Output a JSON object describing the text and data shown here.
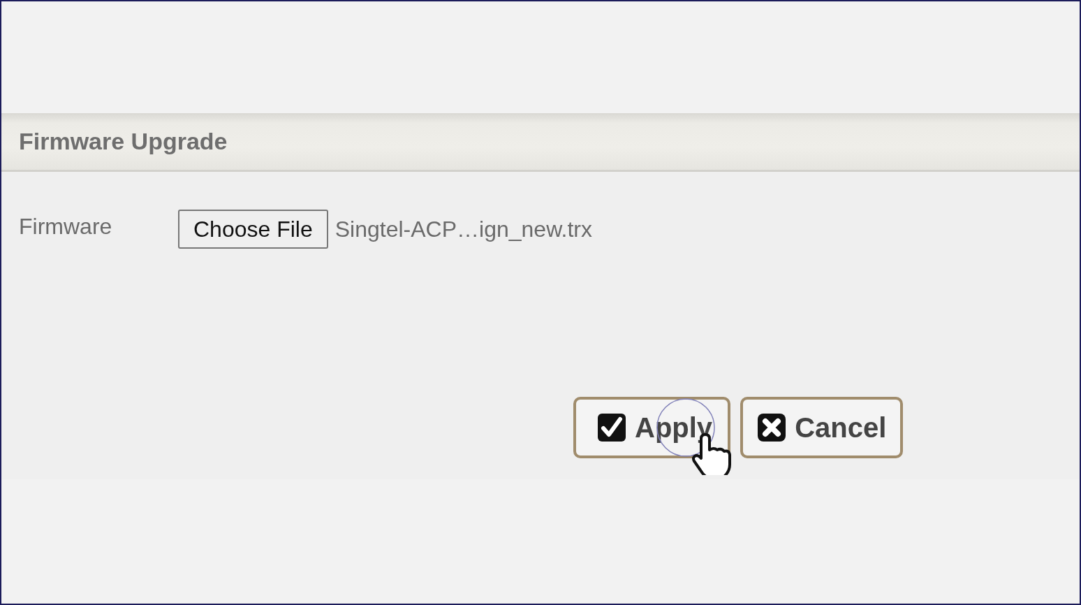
{
  "section": {
    "title": "Firmware Upgrade"
  },
  "form": {
    "label": "Firmware",
    "file_button": "Choose File",
    "file_name": "Singtel-ACP…ign_new.trx"
  },
  "buttons": [
    {
      "kind": "apply",
      "label": "Apply"
    },
    {
      "kind": "cancel",
      "label": "Cancel"
    }
  ]
}
